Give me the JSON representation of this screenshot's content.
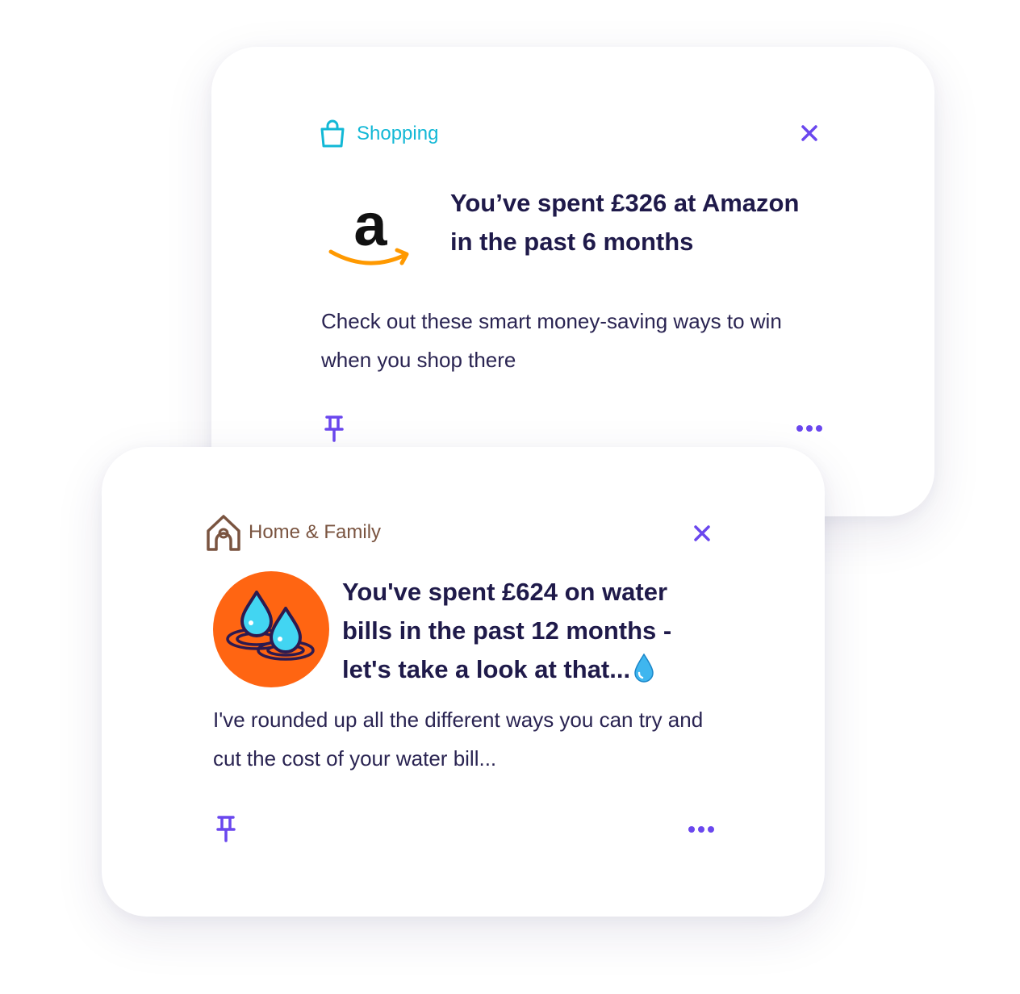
{
  "colors": {
    "accent": "#6a47ee",
    "shopping": "#12b8d6",
    "home": "#7a5440",
    "water_bg": "#ff6512",
    "amazon_orange": "#ff9900",
    "text": "#1f1a4a"
  },
  "cards": [
    {
      "category": "Shopping",
      "category_icon": "shopping-bag-icon",
      "logo": "amazon-logo",
      "headline": "You’ve spent £326 at Amazon in the past 6 months",
      "body": "Check out these smart money-saving ways to win when you shop there",
      "actions": {
        "pin_icon": "pin-icon",
        "more_icon": "more-dots-icon",
        "close_icon": "close-icon"
      }
    },
    {
      "category": "Home & Family",
      "category_icon": "house-icon",
      "logo": "water-drops-icon",
      "headline": "You've spent £624 on water bills in the past 12 months - let's take a look at that...",
      "headline_emoji": "water-drop-emoji",
      "body": "I've rounded up all the different ways you can try and cut the cost of your water bill...",
      "actions": {
        "pin_icon": "pin-icon",
        "more_icon": "more-dots-icon",
        "close_icon": "close-icon"
      }
    }
  ]
}
